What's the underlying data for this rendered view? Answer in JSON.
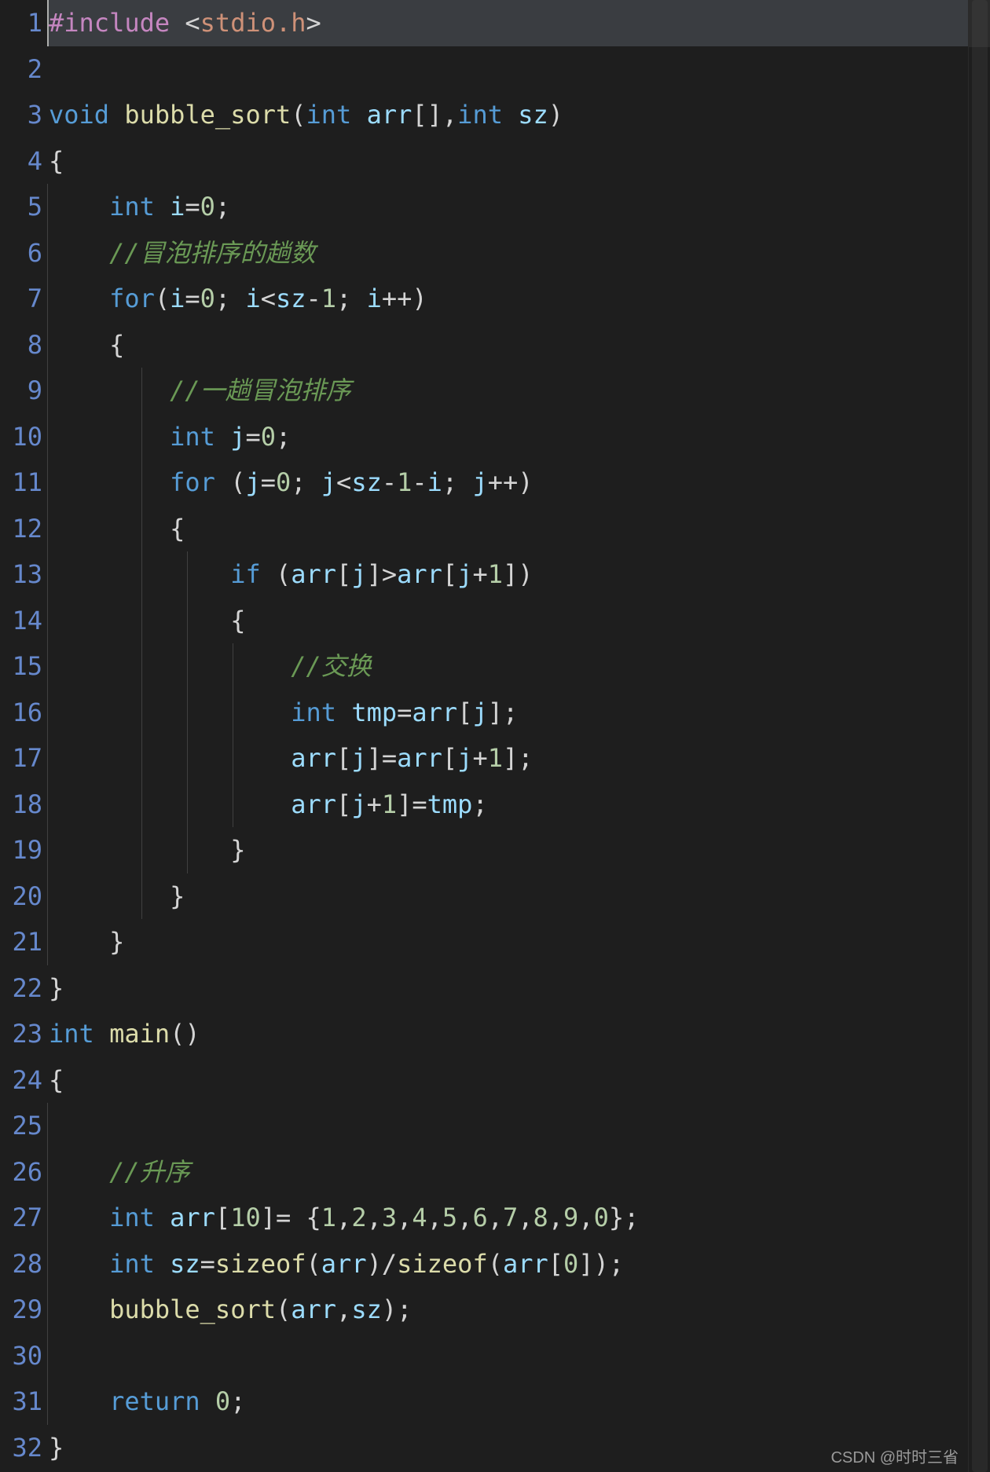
{
  "watermark": "CSDN @时时三省",
  "lines": [
    {
      "n": "1",
      "html": "<span class='pre'>#include</span> <span class='pun'>&lt;</span><span class='str'>stdio.h</span><span class='pun'>&gt;</span>",
      "hl": true
    },
    {
      "n": "2",
      "html": ""
    },
    {
      "n": "3",
      "html": "<span class='kw'>void</span> <span class='fn'>bubble_sort</span><span class='pun'>(</span><span class='type'>int</span> <span class='var'>arr</span><span class='pun'>[]</span><span class='pun'>,</span><span class='type'>int</span> <span class='var'>sz</span><span class='pun'>)</span>"
    },
    {
      "n": "4",
      "html": "<span class='pun'>{</span>"
    },
    {
      "n": "5",
      "html": "    <span class='type'>int</span> <span class='var'>i</span><span class='op'>=</span><span class='num'>0</span><span class='pun'>;</span>"
    },
    {
      "n": "6",
      "html": "    <span class='cmt'>//冒泡排序的趟数</span>"
    },
    {
      "n": "7",
      "html": "    <span class='kw'>for</span><span class='pun'>(</span><span class='var'>i</span><span class='op'>=</span><span class='num'>0</span><span class='pun'>;</span> <span class='var'>i</span><span class='op'>&lt;</span><span class='var'>sz</span><span class='op'>-</span><span class='num'>1</span><span class='pun'>;</span> <span class='var'>i</span><span class='op'>++</span><span class='pun'>)</span>"
    },
    {
      "n": "8",
      "html": "    <span class='pun'>{</span>"
    },
    {
      "n": "9",
      "html": "        <span class='cmt'>//一趟冒泡排序</span>"
    },
    {
      "n": "10",
      "html": "        <span class='type'>int</span> <span class='var'>j</span><span class='op'>=</span><span class='num'>0</span><span class='pun'>;</span>"
    },
    {
      "n": "11",
      "html": "        <span class='kw'>for</span> <span class='pun'>(</span><span class='var'>j</span><span class='op'>=</span><span class='num'>0</span><span class='pun'>;</span> <span class='var'>j</span><span class='op'>&lt;</span><span class='var'>sz</span><span class='op'>-</span><span class='num'>1</span><span class='op'>-</span><span class='var'>i</span><span class='pun'>;</span> <span class='var'>j</span><span class='op'>++</span><span class='pun'>)</span>"
    },
    {
      "n": "12",
      "html": "        <span class='pun'>{</span>"
    },
    {
      "n": "13",
      "html": "            <span class='kw'>if</span> <span class='pun'>(</span><span class='var'>arr</span><span class='pun'>[</span><span class='var'>j</span><span class='pun'>]</span><span class='op'>&gt;</span><span class='var'>arr</span><span class='pun'>[</span><span class='var'>j</span><span class='op'>+</span><span class='num'>1</span><span class='pun'>]</span><span class='pun'>)</span>"
    },
    {
      "n": "14",
      "html": "            <span class='pun'>{</span>"
    },
    {
      "n": "15",
      "html": "                <span class='cmt'>//交换</span>"
    },
    {
      "n": "16",
      "html": "                <span class='type'>int</span> <span class='var'>tmp</span><span class='op'>=</span><span class='var'>arr</span><span class='pun'>[</span><span class='var'>j</span><span class='pun'>]</span><span class='pun'>;</span>"
    },
    {
      "n": "17",
      "html": "                <span class='var'>arr</span><span class='pun'>[</span><span class='var'>j</span><span class='pun'>]</span><span class='op'>=</span><span class='var'>arr</span><span class='pun'>[</span><span class='var'>j</span><span class='op'>+</span><span class='num'>1</span><span class='pun'>]</span><span class='pun'>;</span>"
    },
    {
      "n": "18",
      "html": "                <span class='var'>arr</span><span class='pun'>[</span><span class='var'>j</span><span class='op'>+</span><span class='num'>1</span><span class='pun'>]</span><span class='op'>=</span><span class='var'>tmp</span><span class='pun'>;</span>"
    },
    {
      "n": "19",
      "html": "            <span class='pun'>}</span>"
    },
    {
      "n": "20",
      "html": "        <span class='pun'>}</span>"
    },
    {
      "n": "21",
      "html": "    <span class='pun'>}</span>"
    },
    {
      "n": "22",
      "html": "<span class='pun'>}</span>"
    },
    {
      "n": "23",
      "html": "<span class='type'>int</span> <span class='fn'>main</span><span class='pun'>(</span><span class='pun'>)</span>"
    },
    {
      "n": "24",
      "html": "<span class='pun'>{</span>"
    },
    {
      "n": "25",
      "html": ""
    },
    {
      "n": "26",
      "html": "    <span class='cmt'>//升序</span>"
    },
    {
      "n": "27",
      "html": "    <span class='type'>int</span> <span class='var'>arr</span><span class='pun'>[</span><span class='num'>10</span><span class='pun'>]</span><span class='op'>=</span> <span class='pun'>{</span><span class='num'>1</span><span class='pun'>,</span><span class='num'>2</span><span class='pun'>,</span><span class='num'>3</span><span class='pun'>,</span><span class='num'>4</span><span class='pun'>,</span><span class='num'>5</span><span class='pun'>,</span><span class='num'>6</span><span class='pun'>,</span><span class='num'>7</span><span class='pun'>,</span><span class='num'>8</span><span class='pun'>,</span><span class='num'>9</span><span class='pun'>,</span><span class='num'>0</span><span class='pun'>}</span><span class='pun'>;</span>"
    },
    {
      "n": "28",
      "html": "    <span class='type'>int</span> <span class='var'>sz</span><span class='op'>=</span><span class='fn'>sizeof</span><span class='pun'>(</span><span class='var'>arr</span><span class='pun'>)</span><span class='op'>/</span><span class='fn'>sizeof</span><span class='pun'>(</span><span class='var'>arr</span><span class='pun'>[</span><span class='num'>0</span><span class='pun'>]</span><span class='pun'>)</span><span class='pun'>;</span>"
    },
    {
      "n": "29",
      "html": "    <span class='fn'>bubble_sort</span><span class='pun'>(</span><span class='var'>arr</span><span class='pun'>,</span><span class='var'>sz</span><span class='pun'>)</span><span class='pun'>;</span>"
    },
    {
      "n": "30",
      "html": ""
    },
    {
      "n": "31",
      "html": "    <span class='kw'>return</span> <span class='num'>0</span><span class='pun'>;</span>"
    },
    {
      "n": "32",
      "html": "<span class='pun'>}</span>"
    }
  ],
  "guides": {
    "1": [],
    "2": [],
    "3": [],
    "4": [],
    "5": [
      "g0"
    ],
    "6": [
      "g0"
    ],
    "7": [
      "g0"
    ],
    "8": [
      "g0"
    ],
    "9": [
      "g0",
      "g1"
    ],
    "10": [
      "g0",
      "g1"
    ],
    "11": [
      "g0",
      "g1"
    ],
    "12": [
      "g0",
      "g1"
    ],
    "13": [
      "g0",
      "g1",
      "g2"
    ],
    "14": [
      "g0",
      "g1",
      "g2"
    ],
    "15": [
      "g0",
      "g1",
      "g2",
      "g3"
    ],
    "16": [
      "g0",
      "g1",
      "g2",
      "g3"
    ],
    "17": [
      "g0",
      "g1",
      "g2",
      "g3"
    ],
    "18": [
      "g0",
      "g1",
      "g2",
      "g3"
    ],
    "19": [
      "g0",
      "g1",
      "g2"
    ],
    "20": [
      "g0",
      "g1"
    ],
    "21": [
      "g0"
    ],
    "22": [],
    "23": [],
    "24": [],
    "25": [
      "g0"
    ],
    "26": [
      "g0"
    ],
    "27": [
      "g0"
    ],
    "28": [
      "g0"
    ],
    "29": [
      "g0"
    ],
    "30": [
      "g0"
    ],
    "31": [
      "g0"
    ],
    "32": []
  }
}
